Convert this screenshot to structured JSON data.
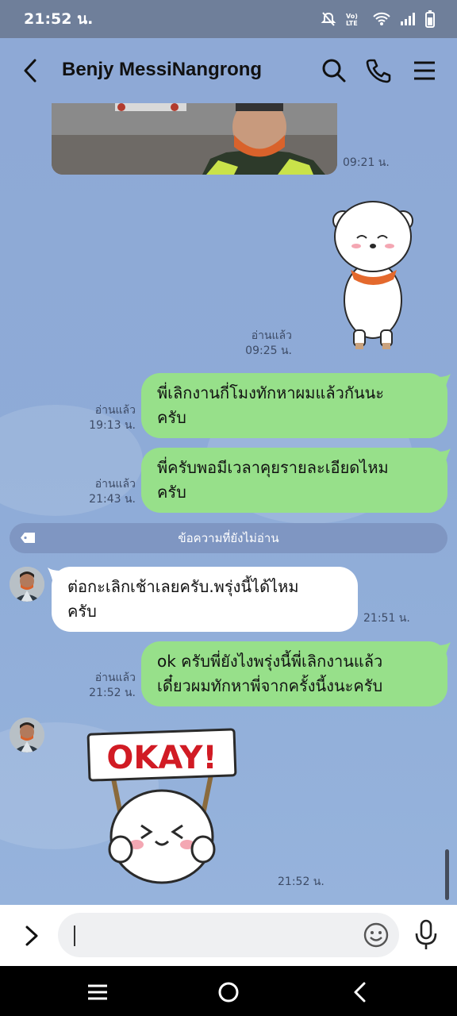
{
  "status_bar": {
    "time": "21:52 น."
  },
  "header": {
    "title": "Benjy MessiNangrong"
  },
  "messages": {
    "photo_time": "09:21 น.",
    "sticker1_read": "อ่านแล้ว",
    "sticker1_time": "09:25 น.",
    "m1_read": "อ่านแล้ว",
    "m1_time": "19:13 น.",
    "m1_line1": "พี่เลิกงานกี่โมงทักหาผมแล้วกันนะ",
    "m1_line2": "ครับ",
    "m2_read": "อ่านแล้ว",
    "m2_time": "21:43 น.",
    "m2_line1": "พี่ครับพอมีเวลาคุยรายละเอียดไหม",
    "m2_line2": "ครับ",
    "unread_label": "ข้อความที่ยังไม่อ่าน",
    "m3_line1": "ต่อกะเลิกเช้าเลยครับ.พรุ่งนี้ได้ไหม",
    "m3_line2": "ครับ",
    "m3_time": "21:51 น.",
    "m4_read": "อ่านแล้ว",
    "m4_time": "21:52 น.",
    "m4_line1": "ok ครับพี่ยังไงพรุ่งนี้พี่เลิกงานแล้ว",
    "m4_line2": "เดี๋ยวผมทักหาพี่จากครั้งนี้งนะครับ",
    "sticker2_text": "OKAY!",
    "sticker2_time": "21:52 น."
  },
  "input": {
    "placeholder": ""
  },
  "icons": [
    "back-icon",
    "search-icon",
    "phone-icon",
    "menu-icon",
    "chevron-right-icon",
    "emoji-icon",
    "mic-icon",
    "nav-recents-icon",
    "nav-home-icon",
    "nav-back-icon"
  ],
  "colors": {
    "outgoing_bubble": "#97e08a",
    "incoming_bubble": "#ffffff",
    "chat_background": "#8ea9d6"
  }
}
